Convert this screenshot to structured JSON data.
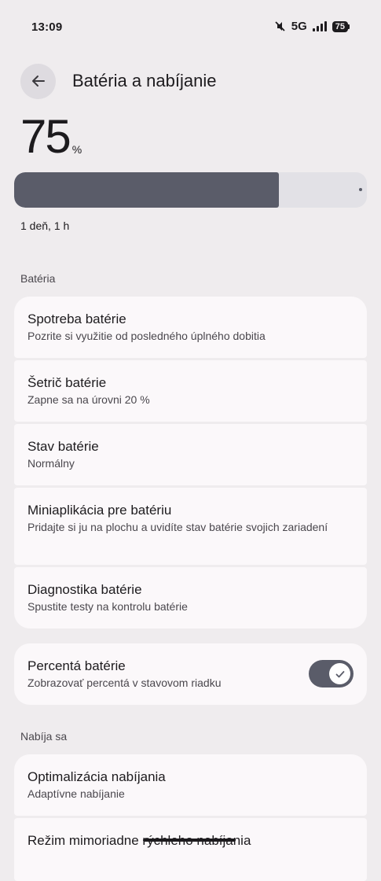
{
  "status_bar": {
    "time": "13:09",
    "network": "5G",
    "battery": "75",
    "icons": [
      "mute-icon",
      "signal-icon",
      "battery-icon"
    ]
  },
  "header": {
    "title": "Batéria a nabíjanie",
    "back_icon": "arrow-left-icon"
  },
  "battery": {
    "level": "75",
    "unit": "%",
    "level_fraction": 0.75,
    "remaining": "1 deň, 1 h"
  },
  "section_battery": {
    "label": "Batéria",
    "items": [
      {
        "title": "Spotreba batérie",
        "subtitle": "Pozrite si využitie od posledného úplného dobitia"
      },
      {
        "title": "Šetrič batérie",
        "subtitle": "Zapne sa na úrovni 20 %"
      },
      {
        "title": "Stav batérie",
        "subtitle": "Normálny"
      },
      {
        "title": "Miniaplikácia pre batériu",
        "subtitle": "Pridajte si ju na plochu a uvidíte stav batérie svojich zariadení"
      },
      {
        "title": "Diagnostika batérie",
        "subtitle": "Spustite testy na kontrolu batérie"
      }
    ]
  },
  "battery_percentage": {
    "title": "Percentá batérie",
    "subtitle": "Zobrazovať percentá v stavovom riadku",
    "enabled": true
  },
  "section_charging": {
    "label": "Nabíja sa",
    "items": [
      {
        "title": "Optimalizácia nabíjania",
        "subtitle": "Adaptívne nabíjanie"
      },
      {
        "title": "Režim mimoriadne rýchleho nabíjania"
      }
    ]
  },
  "colors": {
    "background": "#efecee",
    "card": "#fbf8fa",
    "accent": "#5a5c69"
  }
}
